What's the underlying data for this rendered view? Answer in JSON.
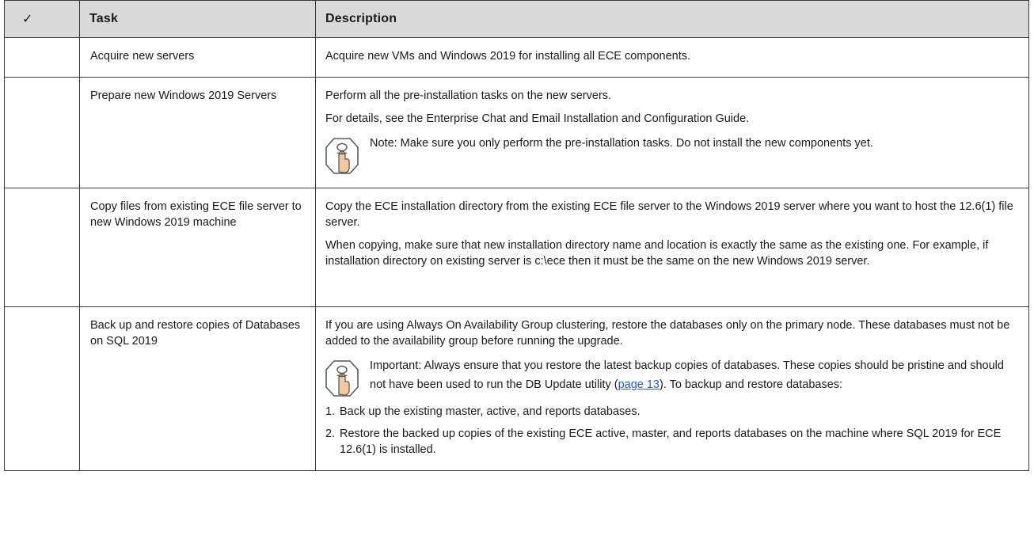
{
  "header": {
    "check_symbol": "✓",
    "task_label": "Task",
    "description_label": "Description"
  },
  "rows": [
    {
      "task": "Acquire new servers",
      "paragraphs": [
        "Acquire new VMs and Windows 2019 for installing all ECE components."
      ]
    },
    {
      "task": "Prepare new Windows 2019 Servers",
      "paragraphs": [
        "Perform all the pre-installation tasks on the new servers.",
        "For details, see the Enterprise Chat and Email Installation and Configuration Guide."
      ],
      "note": "Note: Make sure you only perform the pre-installation tasks. Do not install the new components yet."
    },
    {
      "task": "Copy files from existing ECE file server to new Windows 2019 machine",
      "paragraphs": [
        "Copy the ECE installation directory from the existing ECE file server to the Windows 2019 server where you want to host the 12.6(1) file server.",
        "When copying, make sure that new installation directory name and location is exactly the same as the existing one. For example, if installation directory on existing server is c:\\ece then it must be the same on the new Windows 2019 server."
      ]
    },
    {
      "task": "Back up and restore copies of Databases on SQL 2019",
      "paragraphs": [
        "If you are using Always On Availability Group clustering, restore the databases only on the primary node. These databases must not be added to the availability group before running the upgrade."
      ],
      "note_before": "Important: Always ensure that you restore the latest backup copies of databases. These copies should be pristine and should not have been used to run the DB Update utility (",
      "note_link": "page 13",
      "note_after": "). To backup and restore databases:",
      "steps": [
        {
          "n": "1.",
          "text": "Back up the existing master, active, and reports databases."
        },
        {
          "n": "2.",
          "text": "Restore the backed up copies of the existing ECE active, master, and reports databases on the machine where SQL 2019 for ECE 12.6(1) is installed."
        }
      ]
    }
  ],
  "colors": {
    "header_bg": "#d9d9d9",
    "border": "#3a3a3a",
    "link": "#1f5fd6",
    "note_icon_fill": "#f4c9a0",
    "note_icon_stroke": "#5a5a5a"
  }
}
